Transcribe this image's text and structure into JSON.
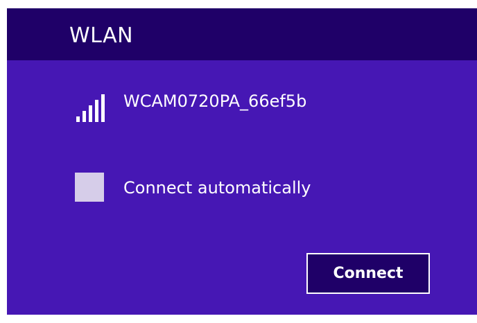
{
  "header": {
    "title": "WLAN"
  },
  "network": {
    "name": "WCAM0720PA_66ef5b",
    "signal_icon": "wifi-signal-bars-icon",
    "signal_bars": 5,
    "signal_bars_filled": 5
  },
  "auto_connect": {
    "label": "Connect automatically",
    "checked": false
  },
  "actions": {
    "connect_label": "Connect"
  },
  "colors": {
    "panel_background": "#4617b4",
    "header_background": "#1f0068",
    "button_background": "#1f0068",
    "checkbox_fill": "#d6cde9",
    "text": "#ffffff"
  }
}
